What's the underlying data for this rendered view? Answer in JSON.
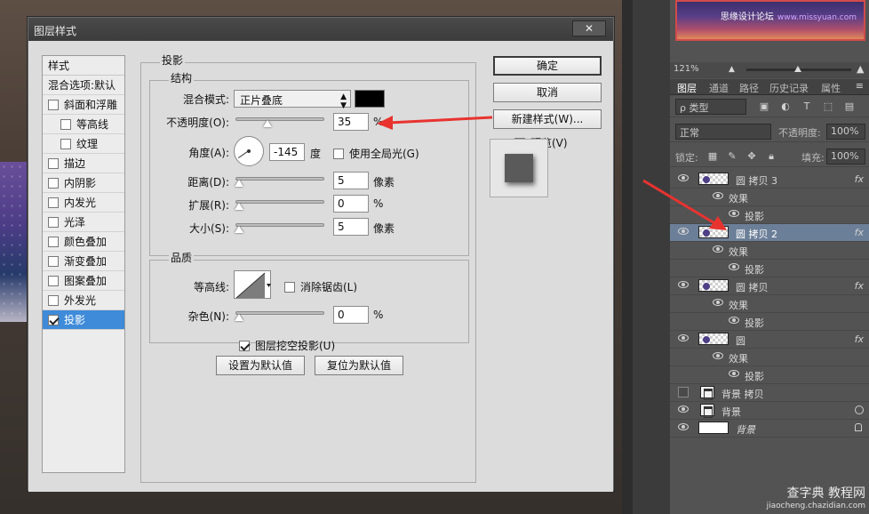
{
  "dialog": {
    "title": "图层样式",
    "close": "✕",
    "style_list": {
      "header": "样式",
      "items": [
        {
          "label": "混合选项:默认",
          "checkbox": false,
          "checked": false,
          "indent": false,
          "selected": false
        },
        {
          "label": "斜面和浮雕",
          "checkbox": true,
          "checked": false,
          "indent": false,
          "selected": false
        },
        {
          "label": "等高线",
          "checkbox": true,
          "checked": false,
          "indent": true,
          "selected": false
        },
        {
          "label": "纹理",
          "checkbox": true,
          "checked": false,
          "indent": true,
          "selected": false
        },
        {
          "label": "描边",
          "checkbox": true,
          "checked": false,
          "indent": false,
          "selected": false
        },
        {
          "label": "内阴影",
          "checkbox": true,
          "checked": false,
          "indent": false,
          "selected": false
        },
        {
          "label": "内发光",
          "checkbox": true,
          "checked": false,
          "indent": false,
          "selected": false
        },
        {
          "label": "光泽",
          "checkbox": true,
          "checked": false,
          "indent": false,
          "selected": false
        },
        {
          "label": "颜色叠加",
          "checkbox": true,
          "checked": false,
          "indent": false,
          "selected": false
        },
        {
          "label": "渐变叠加",
          "checkbox": true,
          "checked": false,
          "indent": false,
          "selected": false
        },
        {
          "label": "图案叠加",
          "checkbox": true,
          "checked": false,
          "indent": false,
          "selected": false
        },
        {
          "label": "外发光",
          "checkbox": true,
          "checked": false,
          "indent": false,
          "selected": false
        },
        {
          "label": "投影",
          "checkbox": true,
          "checked": true,
          "indent": false,
          "selected": true
        }
      ]
    },
    "drop_shadow": {
      "title": "投影",
      "structure": {
        "title": "结构",
        "blend_mode_label": "混合模式:",
        "blend_mode_value": "正片叠底",
        "shadow_color": "#000000",
        "opacity_label": "不透明度(O):",
        "opacity_value": "35",
        "opacity_unit": "%",
        "angle_label": "角度(A):",
        "angle_value": "-145",
        "angle_unit": "度",
        "global_light_label": "使用全局光(G)",
        "global_light_checked": false,
        "distance_label": "距离(D):",
        "distance_value": "5",
        "distance_unit": "像素",
        "spread_label": "扩展(R):",
        "spread_value": "0",
        "spread_unit": "%",
        "size_label": "大小(S):",
        "size_value": "5",
        "size_unit": "像素"
      },
      "quality": {
        "title": "品质",
        "contour_label": "等高线:",
        "antialias_label": "消除锯齿(L)",
        "antialias_checked": false,
        "noise_label": "杂色(N):",
        "noise_value": "0",
        "noise_unit": "%"
      },
      "knockout_label": "图层挖空投影(U)",
      "knockout_checked": true,
      "make_default": "设置为默认值",
      "reset_default": "复位为默认值"
    },
    "buttons": {
      "ok": "确定",
      "cancel": "取消",
      "new_style": "新建样式(W)...",
      "preview_label": "预览(V)",
      "preview_checked": true
    }
  },
  "panel": {
    "thumbnail_text": "思缘设计论坛",
    "thumbnail_site": "www.missyuan.com",
    "zoom": "121%",
    "tabs": [
      "图层",
      "通道",
      "路径",
      "历史记录",
      "属性"
    ],
    "active_tab": "图层",
    "filter_label": "ρ 类型",
    "blend_mode": "正常",
    "opacity_label": "不透明度:",
    "opacity_value": "100%",
    "lock_label": "锁定:",
    "fill_label": "填充:",
    "fill_value": "100%",
    "layers": [
      {
        "name": "圆 拷贝 3",
        "type": "layer",
        "visible": true,
        "fx": true,
        "selected": false
      },
      {
        "name": "效果",
        "type": "effects",
        "visible": true
      },
      {
        "name": "投影",
        "type": "effect",
        "visible": true
      },
      {
        "name": "圆 拷贝 2",
        "type": "layer",
        "visible": true,
        "fx": true,
        "selected": true
      },
      {
        "name": "效果",
        "type": "effects",
        "visible": true
      },
      {
        "name": "投影",
        "type": "effect",
        "visible": true
      },
      {
        "name": "圆 拷贝",
        "type": "layer",
        "visible": true,
        "fx": true,
        "selected": false
      },
      {
        "name": "效果",
        "type": "effects",
        "visible": true
      },
      {
        "name": "投影",
        "type": "effect",
        "visible": true
      },
      {
        "name": "圆",
        "type": "layer",
        "visible": true,
        "fx": true,
        "selected": false
      },
      {
        "name": "效果",
        "type": "effects",
        "visible": true
      },
      {
        "name": "投影",
        "type": "effect",
        "visible": true
      },
      {
        "name": "背景 拷贝",
        "type": "doc",
        "visible": false,
        "selected": false
      },
      {
        "name": "背景",
        "type": "doc",
        "visible": true,
        "selected": false,
        "link": true
      },
      {
        "name": "背景",
        "type": "white",
        "visible": true,
        "selected": false,
        "italic": true,
        "locked": true
      }
    ],
    "fx_label": "fx"
  },
  "watermark": {
    "main": "查字典 教程网",
    "sub": "jiaocheng.chazidian.com"
  },
  "annotations": {
    "arrow_color": "#e8332f"
  }
}
